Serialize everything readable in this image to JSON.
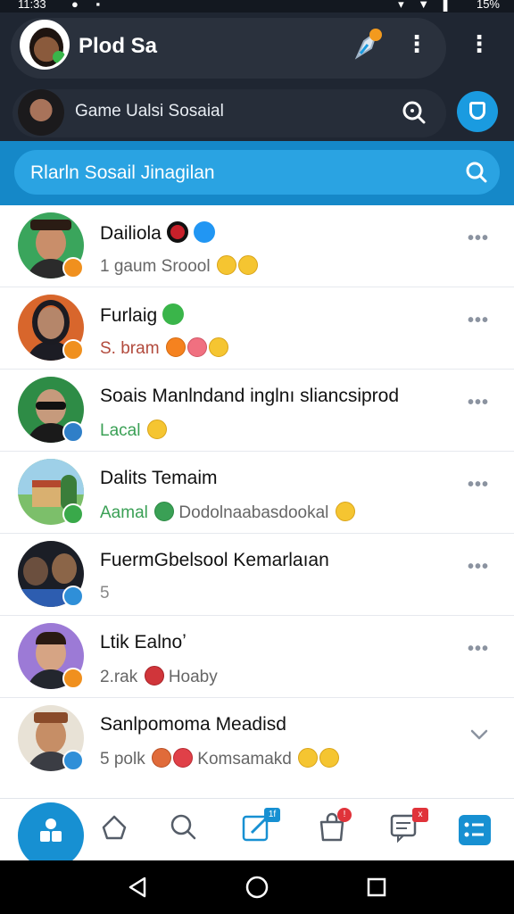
{
  "status_bar": {
    "time": "11:33",
    "battery": "15%"
  },
  "header": {
    "app_name": "Plod Sa"
  },
  "sub_header": {
    "title": "Game Ualsi Sosaial"
  },
  "search": {
    "placeholder": "Rlarln Sosail Jinagilan"
  },
  "chats": [
    {
      "name": "Dailiola",
      "preview_prefix": "1  gaum Sroool",
      "preview_color": "#666666",
      "name_icons": [
        "red-heart-icon",
        "verified-check-icon"
      ],
      "preview_emojis": 2,
      "action": "more"
    },
    {
      "name": "Furlaig",
      "preview_prefix": "S. bram",
      "preview_color": "#b24a3c",
      "name_icons": [
        "green-chat-icon"
      ],
      "preview_emojis": 3,
      "action": "more"
    },
    {
      "name": "Soais Manlndand inglnı sliancsiprod",
      "preview_prefix": "Lacal",
      "preview_color": "#3aa055",
      "name_icons": [],
      "preview_emojis": 1,
      "action": "more"
    },
    {
      "name": "Dalits Temaim",
      "preview_prefix": "Aamal",
      "preview_color": "#3aa055",
      "preview_suffix": "Dodolnaabasdookal",
      "name_icons": [],
      "preview_emojis": 1,
      "action": "more"
    },
    {
      "name": "FuermGbelsool Kemarlaıan",
      "preview_prefix": "5",
      "preview_color": "#888888",
      "name_icons": [],
      "preview_emojis": 0,
      "action": "more"
    },
    {
      "name": "Ltik Ealnoʼ",
      "preview_prefix": "2.rak",
      "preview_color": "#666666",
      "preview_suffix": "Hoaby",
      "name_icons": [],
      "preview_emojis": 1,
      "action": "more"
    },
    {
      "name": "Sanlpomoma Meadisd",
      "preview_prefix": "5 polk",
      "preview_color": "#666666",
      "preview_suffix": "Komsamakd",
      "name_icons": [],
      "preview_emojis": 2,
      "action": "chevron"
    }
  ],
  "bottom_nav": {
    "compose_badge": "1f",
    "alerts_badge": "!",
    "messages_badge": "x"
  },
  "colors": {
    "accent": "#1790d2",
    "header_bg": "#1f2632",
    "search_band": "#1588c8",
    "badge_red": "#e0333a"
  }
}
